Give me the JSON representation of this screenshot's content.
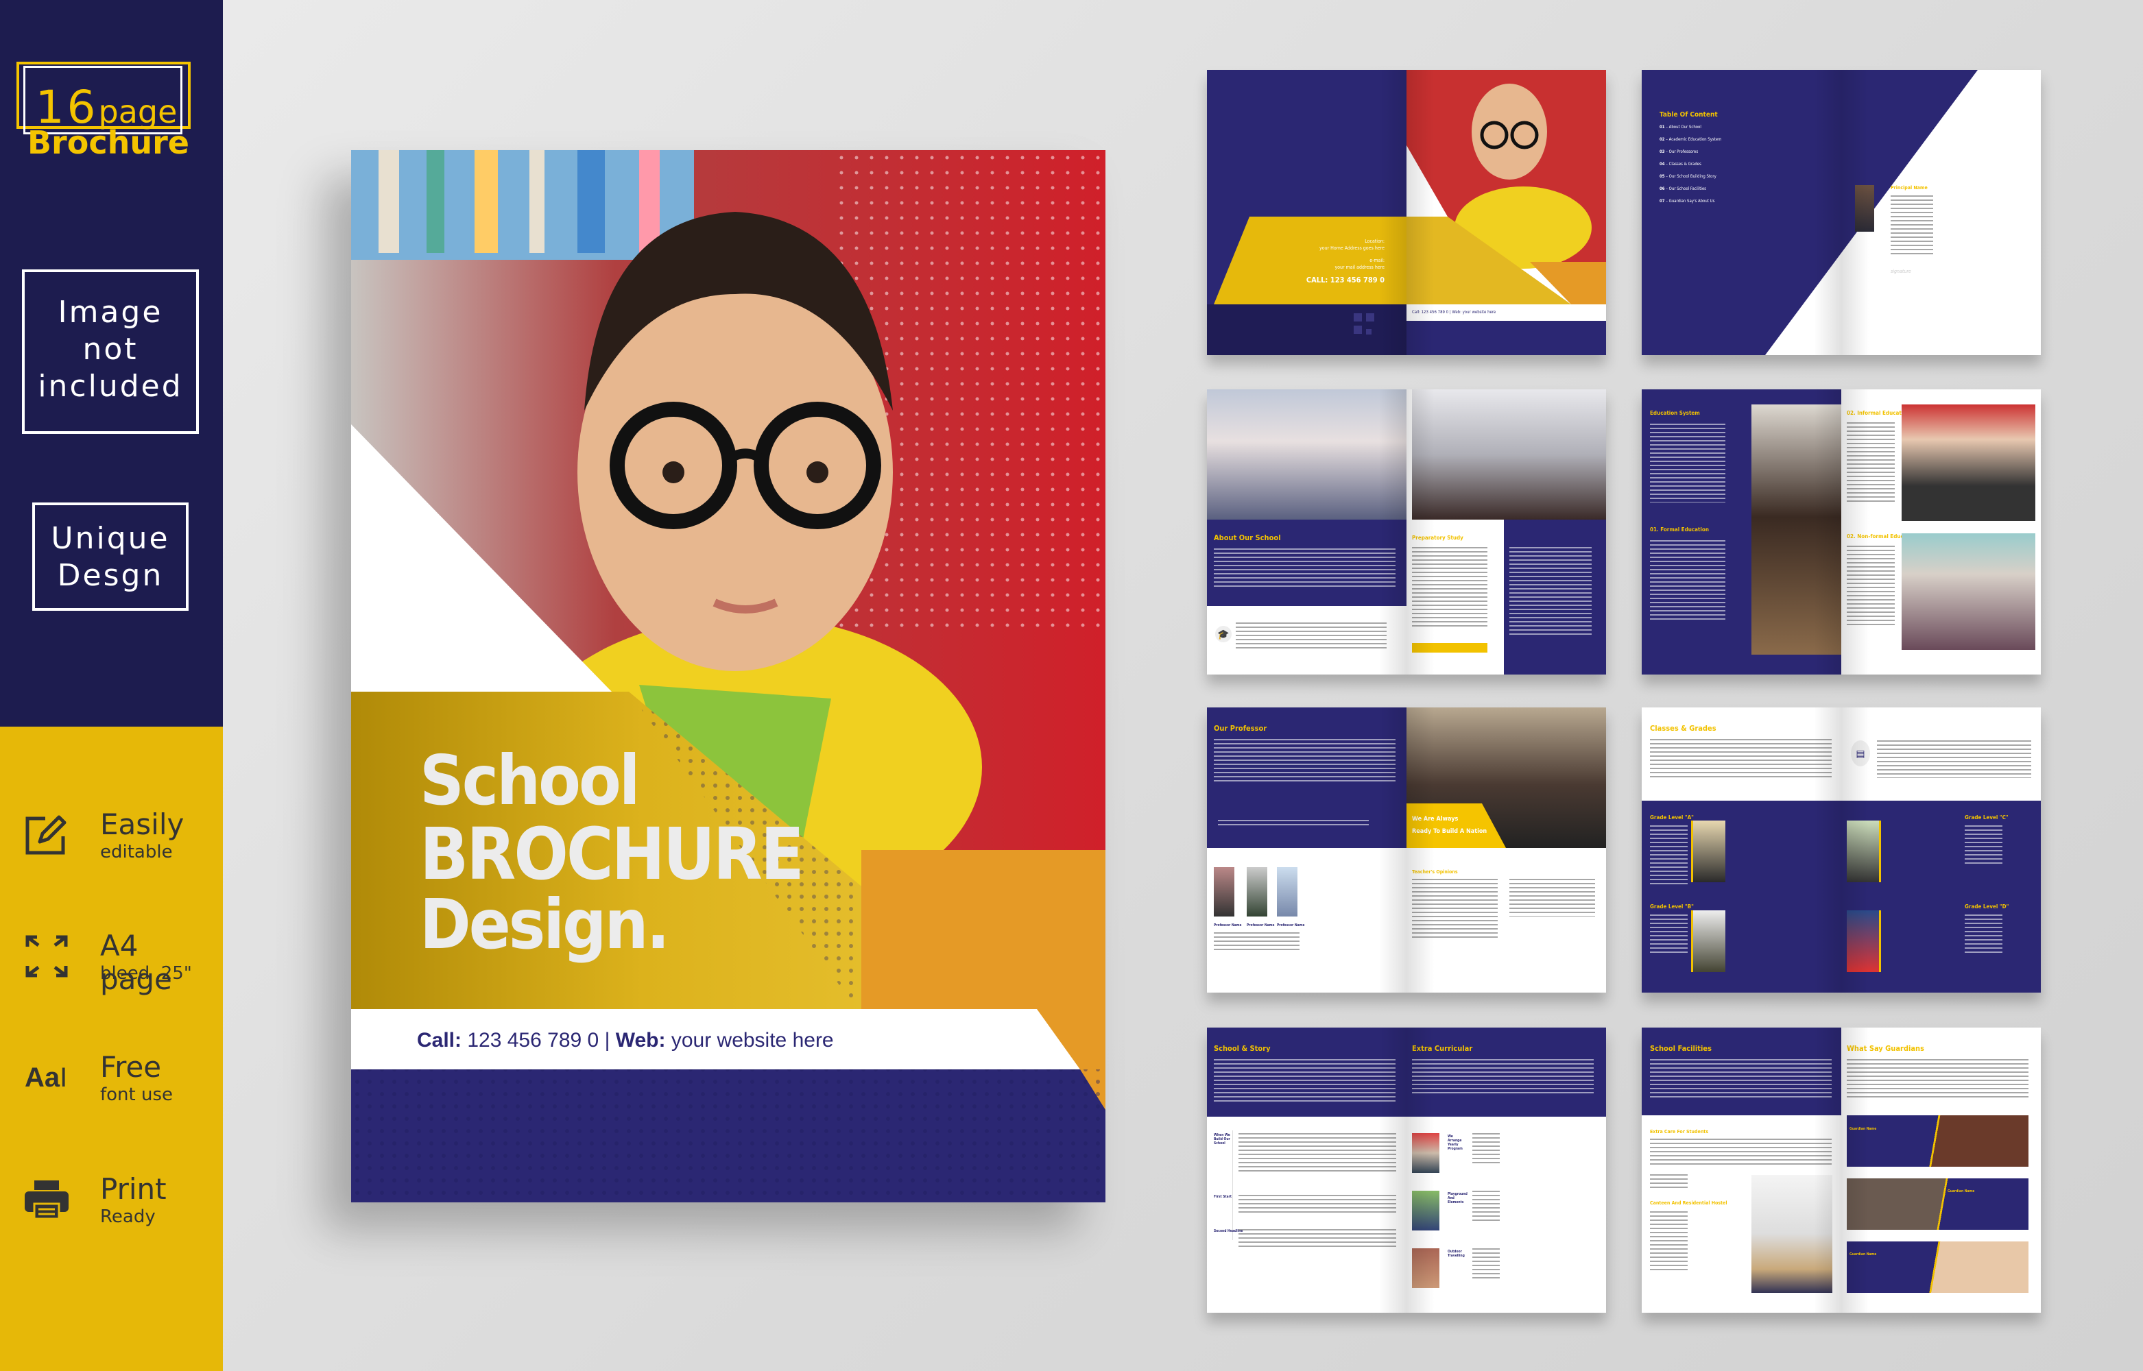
{
  "sidebar": {
    "badge": {
      "number": "16",
      "page": "page",
      "brochure": "Brochure"
    },
    "image_note": [
      "Image",
      "not",
      "included"
    ],
    "unique": [
      "Unique",
      "Desgn"
    ],
    "features": [
      {
        "icon": "edit-icon",
        "title": "Easily",
        "subtitle": "editable"
      },
      {
        "icon": "expand-arrows-icon",
        "title": "A4 page",
        "subtitle": "bleed .25\""
      },
      {
        "icon": "font-icon",
        "title": "Free",
        "subtitle": "font use",
        "icon_text": "Aa"
      },
      {
        "icon": "printer-icon",
        "title": "Print",
        "subtitle": "Ready"
      }
    ]
  },
  "colors": {
    "navy": "#2b2773",
    "sidebar_navy": "#1d1c4f",
    "yellow": "#f2c200",
    "sidebar_yellow": "#e6b808",
    "orange": "#e59a26"
  },
  "cover": {
    "title_1": "School",
    "title_2": "BROCHURE",
    "title_3": "Design.",
    "call_label": "Call:",
    "call_value": "123 456 789 0",
    "separator": "|",
    "web_label": "Web:",
    "web_value": "your website here"
  },
  "spreads": {
    "back_cover": {
      "location_label": "Location:",
      "location_value": "your Home Address goes here",
      "email_label": "e-mail:",
      "email_value": "your mail address here",
      "call": "CALL: 123 456 789 0",
      "mini_footer": "Call: 123 456 789 0 | Web: your website here"
    },
    "toc": {
      "title": "Table Of Content",
      "items": [
        {
          "num": "01",
          "label": "About Our School"
        },
        {
          "num": "02",
          "label": "Academic Education System"
        },
        {
          "num": "03",
          "label": "Our Professores"
        },
        {
          "num": "04",
          "label": "Classes & Grades"
        },
        {
          "num": "05",
          "label": "Our School Building Story"
        },
        {
          "num": "06",
          "label": "Our School Facilities"
        },
        {
          "num": "07",
          "label": "Guardian Say's About Us"
        }
      ],
      "principal": "Principal Name",
      "signature": "signature"
    },
    "about": {
      "title": "About Our School",
      "prep": "Preparatory Study"
    },
    "education": {
      "title": "Education System",
      "formal": "01. Formal Education",
      "informal": "02. Informal Education",
      "nonformal": "02. Non-formal Education"
    },
    "professor": {
      "title": "Our Professor",
      "tagline_1": "We Are Always",
      "tagline_2": "Ready To Build A Nation",
      "names": [
        "Professor Name",
        "Professor Name",
        "Professor Name"
      ],
      "opinions": "Teacher's Opinions"
    },
    "classes": {
      "title": "Classes & Grades",
      "grades": [
        "Grade Level \"A\"",
        "Grade Level \"B\"",
        "Grade Level \"C\"",
        "Grade Level \"D\""
      ]
    },
    "story": {
      "title": "School & Story",
      "timeline": [
        "When We Build Our School",
        "First Start",
        "Second Headline"
      ],
      "extra_title": "Extra Curricular",
      "activities": [
        "We Arrange Yearly Program",
        "Playground And Elements",
        "Outdoor Travelling"
      ]
    },
    "facilities": {
      "title": "School Facilities",
      "care": "Extra Care For Students",
      "canteen": "Canteen And Residential Hostel",
      "guardians_title": "What Say Guardians",
      "guardian_names": [
        "Guardian Name",
        "Guardian Name",
        "Guardian Name"
      ]
    }
  }
}
